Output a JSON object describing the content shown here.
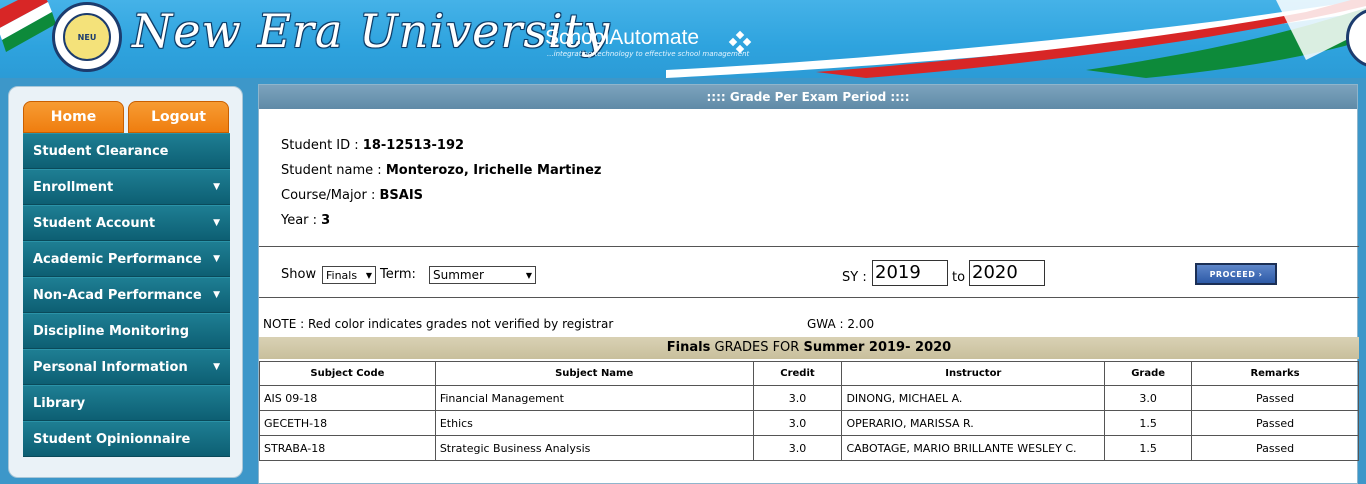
{
  "header": {
    "title": "New Era University",
    "brand": "SchoolAutomate",
    "tagline": "...integrating technology to effective school management"
  },
  "sidebar": {
    "home": "Home",
    "logout": "Logout",
    "items": [
      {
        "label": "Student Clearance",
        "arrow": ""
      },
      {
        "label": "Enrollment",
        "arrow": "▼"
      },
      {
        "label": "Student Account",
        "arrow": "▼"
      },
      {
        "label": "Academic Performance",
        "arrow": "▼"
      },
      {
        "label": "Non-Acad Performance",
        "arrow": "▼"
      },
      {
        "label": "Discipline Monitoring",
        "arrow": ""
      },
      {
        "label": "Personal Information",
        "arrow": "▼"
      },
      {
        "label": "Library",
        "arrow": ""
      },
      {
        "label": "Student Opinionnaire",
        "arrow": ""
      }
    ]
  },
  "panel": {
    "title": ":::: Grade Per Exam Period ::::",
    "student_id_label": "Student ID : ",
    "student_id": "18-12513-192",
    "student_name_label": "Student name : ",
    "student_name": "Monterozo, Irichelle Martinez",
    "course_label": "Course/Major : ",
    "course": "BSAIS",
    "year_label": "Year : ",
    "year": "3"
  },
  "filters": {
    "show_label": "Show",
    "show_value": "Finals",
    "term_label": "Term:",
    "term_value": "Summer",
    "sy_label": "SY :",
    "sy_from": "2019",
    "to_label": "to",
    "sy_to": "2020",
    "proceed": "PROCEED ›"
  },
  "note": "NOTE : Red color indicates grades not verified by registrar",
  "gwa": "GWA : 2.00",
  "grades_title": {
    "period": "Finals",
    "mid": " GRADES FOR ",
    "term": "Summer 2019- 2020"
  },
  "table": {
    "headers": [
      "Subject Code",
      "Subject Name",
      "Credit",
      "Instructor",
      "Grade",
      "Remarks"
    ],
    "rows": [
      [
        "AIS 09-18",
        "Financial Management",
        "3.0",
        "DINONG, MICHAEL A.",
        "3.0",
        "Passed"
      ],
      [
        "GECETH-18",
        "Ethics",
        "3.0",
        "OPERARIO, MARISSA R.",
        "1.5",
        "Passed"
      ],
      [
        "STRABA-18",
        "Strategic Business Analysis",
        "3.0",
        "CABOTAGE, MARIO BRILLANTE WESLEY C.",
        "1.5",
        "Passed"
      ]
    ]
  }
}
